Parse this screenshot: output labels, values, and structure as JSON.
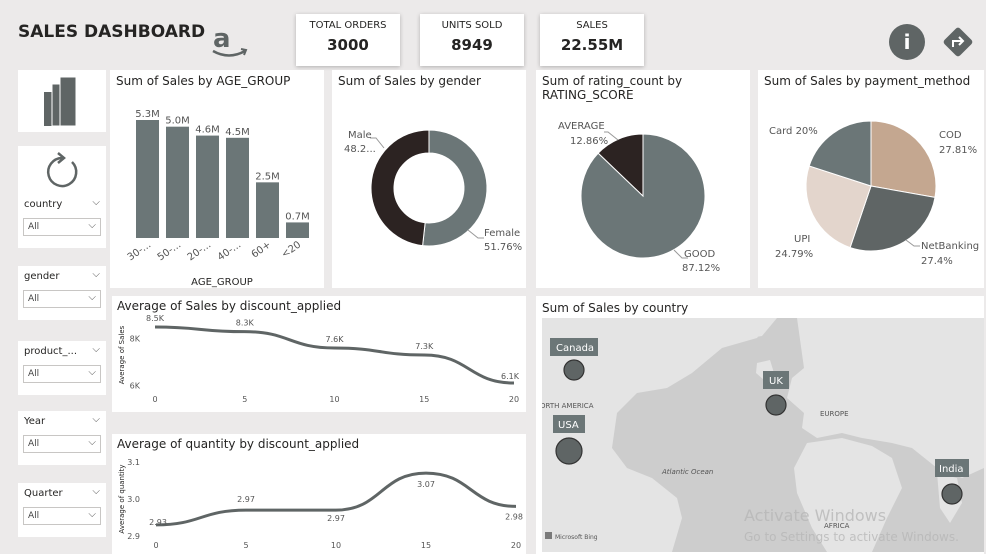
{
  "header": {
    "title": "SALES DASHBOARD",
    "kpis": [
      {
        "label": "TOTAL ORDERS",
        "value": "3000"
      },
      {
        "label": "UNITS SOLD",
        "value": "8949"
      },
      {
        "label": "SALES",
        "value": "22.55M"
      }
    ],
    "icons": [
      "amazon-logo",
      "info-icon",
      "share-arrow-icon"
    ]
  },
  "sidebar": {
    "icons": [
      "report-bars-icon",
      "refresh-icon"
    ],
    "slicers": [
      {
        "label": "country",
        "value": "All"
      },
      {
        "label": "gender",
        "value": "All"
      },
      {
        "label": "product_...",
        "value": "All"
      },
      {
        "label": "Year",
        "value": "All"
      },
      {
        "label": "Quarter",
        "value": "All"
      }
    ]
  },
  "colors": {
    "dark": "#2c2322",
    "slate": "#6b7677",
    "tan": "#c4a790",
    "light": "#e3d5cc",
    "gray": "#5f6565"
  },
  "chart_data": [
    {
      "type": "bar",
      "title": "Sum of Sales by AGE_GROUP",
      "xlabel": "AGE_GROUP",
      "categories": [
        "30-...",
        "50-...",
        "20-...",
        "40-...",
        "60+",
        "<20"
      ],
      "values": [
        5.3,
        5.0,
        4.6,
        4.5,
        2.5,
        0.7
      ],
      "data_labels": [
        "5.3M",
        "5.0M",
        "4.6M",
        "4.5M",
        "2.5M",
        "0.7M"
      ],
      "ylim": [
        0,
        5.3
      ]
    },
    {
      "type": "pie",
      "subtype": "donut",
      "title": "Sum of Sales by gender",
      "slices": [
        {
          "name": "Female",
          "label": "Female",
          "value": 51.76,
          "value_label": "51.76%",
          "color": "#6b7677"
        },
        {
          "name": "Male",
          "label": "Male",
          "value": 48.24,
          "value_label": "48.2...",
          "color": "#2c2322"
        }
      ]
    },
    {
      "type": "pie",
      "title_lines": [
        "Sum of rating_count by",
        "RATING_SCORE"
      ],
      "slices": [
        {
          "name": "GOOD",
          "label": "GOOD",
          "value": 87.12,
          "value_label": "87.12%",
          "color": "#6b7677"
        },
        {
          "name": "AVERAGE",
          "label": "AVERAGE",
          "value": 12.86,
          "value_label": "12.86%",
          "color": "#2c2322"
        }
      ]
    },
    {
      "type": "pie",
      "title": "Sum of Sales by payment_method",
      "slices": [
        {
          "name": "COD",
          "label": "COD",
          "value": 27.81,
          "value_label": "27.81%",
          "color": "#c4a790"
        },
        {
          "name": "NetBanking",
          "label": "NetBanking",
          "value": 27.4,
          "value_label": "27.4%",
          "color": "#5f6565"
        },
        {
          "name": "UPI",
          "label": "UPI",
          "value": 24.79,
          "value_label": "24.79%",
          "color": "#e3d5cc"
        },
        {
          "name": "Card",
          "label": "Card 20%",
          "value": 20.0,
          "value_label": "",
          "color": "#6b7677"
        }
      ]
    },
    {
      "type": "line",
      "title": "Average of Sales by discount_applied",
      "ylabel": "Average of Sales",
      "x": [
        0,
        5,
        10,
        15,
        20
      ],
      "y": [
        8500,
        8300,
        7600,
        7300,
        6100
      ],
      "data_labels": [
        "8.5K",
        "8.3K",
        "7.6K",
        "7.3K",
        "6.1K"
      ],
      "yticks": [
        "6K",
        "8K"
      ],
      "ytick_values": [
        6000,
        8000
      ],
      "ylim": [
        5800,
        8800
      ]
    },
    {
      "type": "line",
      "title": "Average of quantity by discount_applied",
      "ylabel": "Average of quantity",
      "x": [
        0,
        5,
        10,
        15,
        20
      ],
      "y": [
        2.93,
        2.97,
        2.97,
        3.07,
        2.98
      ],
      "data_labels": [
        "2.93",
        "2.97",
        "2.97",
        "3.07",
        "2.98"
      ],
      "yticks": [
        "2.9",
        "3.0",
        "3.1"
      ],
      "ytick_values": [
        2.9,
        3.0,
        3.1
      ],
      "ylim": [
        2.9,
        3.1
      ]
    }
  ],
  "map": {
    "title": "Sum of Sales by country",
    "countries": [
      "Canada",
      "UK",
      "USA",
      "India"
    ],
    "place_labels": [
      "ORTH AMERICA",
      "EUROPE",
      "Atlantic Ocean",
      "AFRICA"
    ],
    "attribution": "Microsoft Bing"
  },
  "watermark": {
    "line1": "Activate Windows",
    "line2": "Go to Settings to activate Windows."
  }
}
